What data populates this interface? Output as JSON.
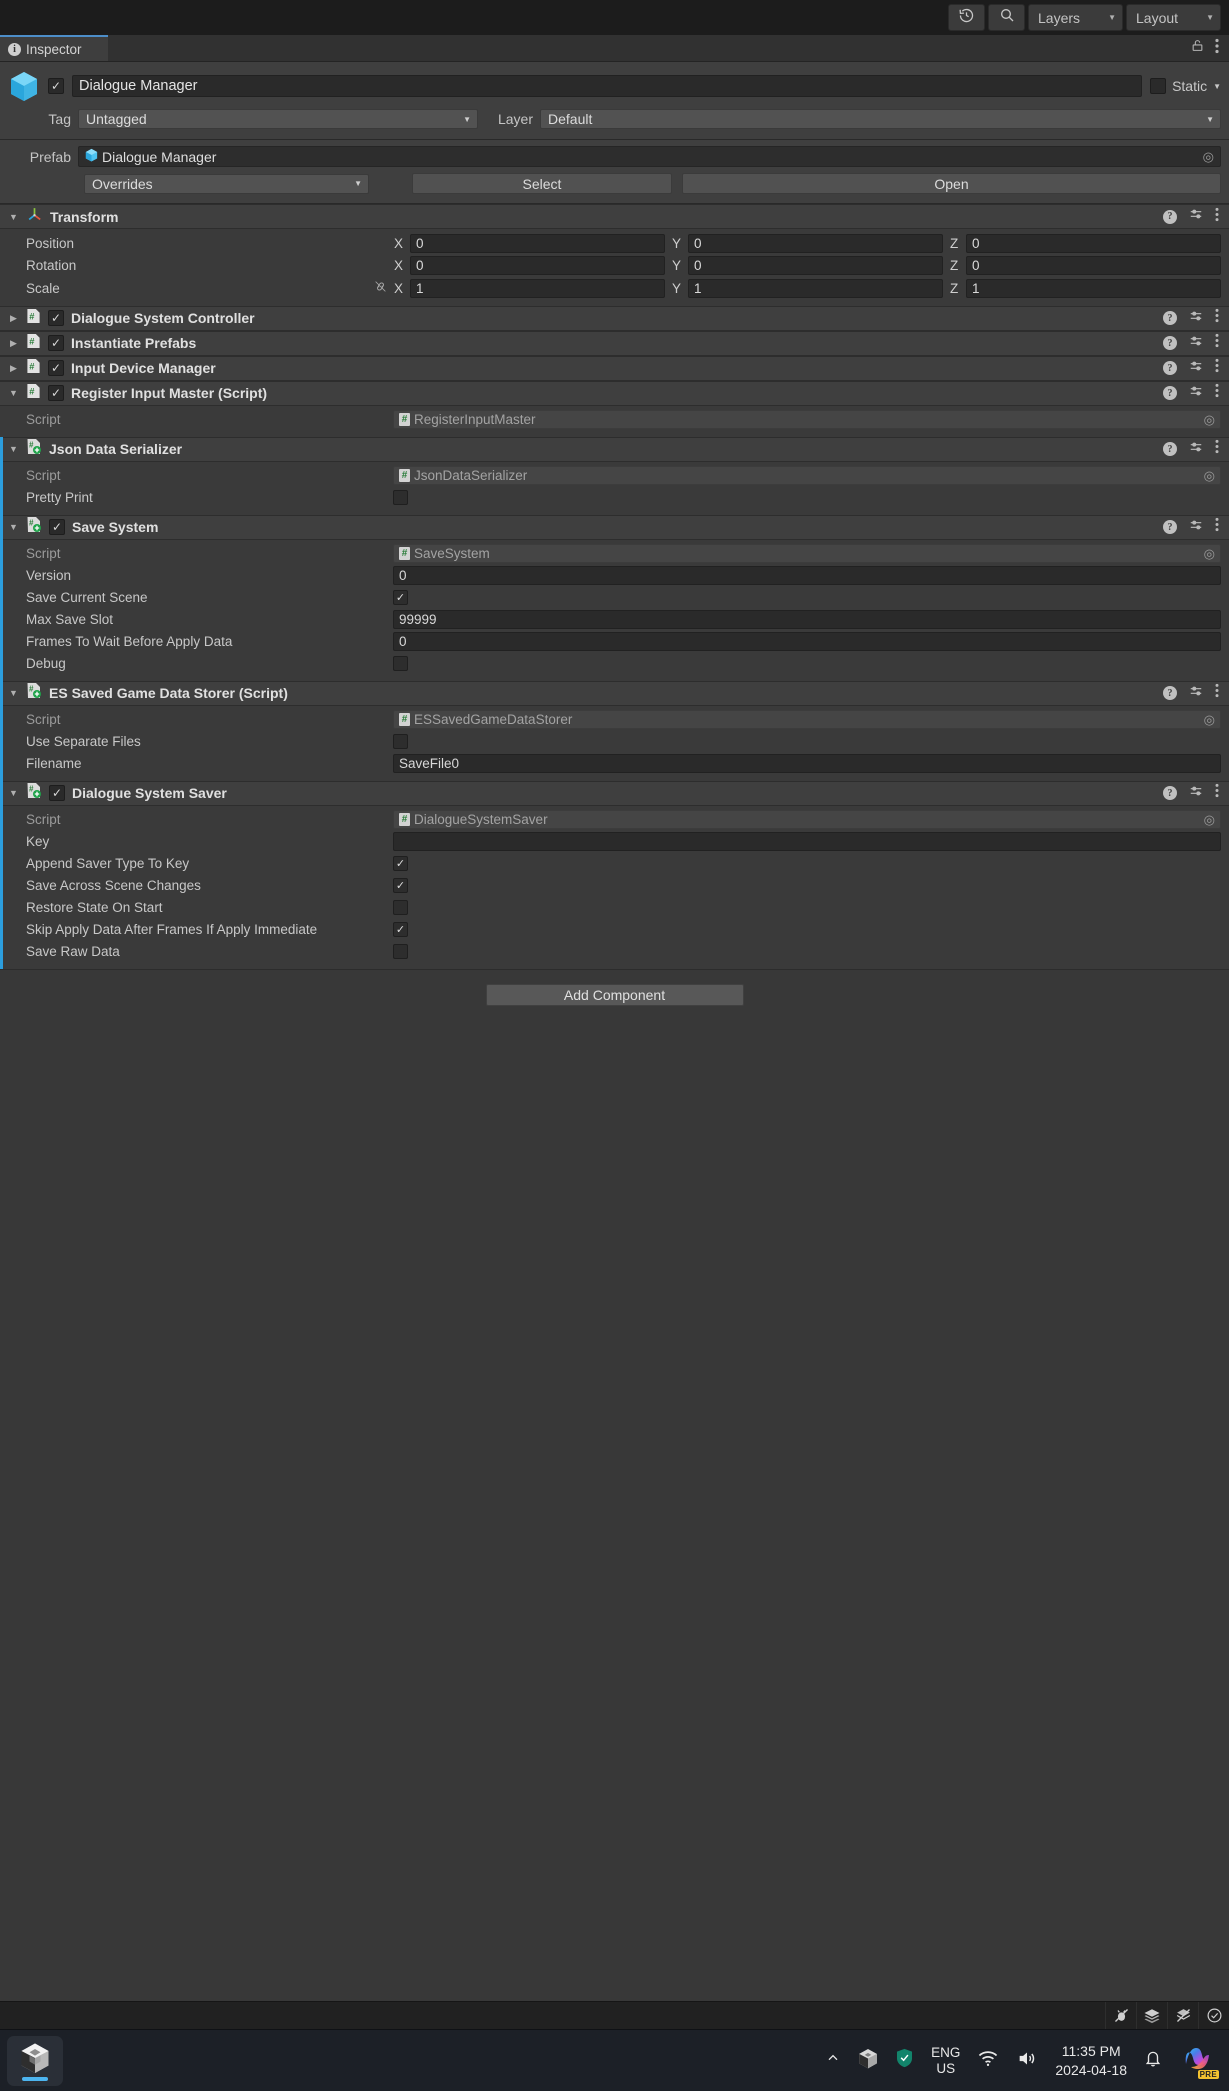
{
  "toolbar": {
    "history_icon": "history-icon",
    "search_icon": "search-icon",
    "layers_label": "Layers",
    "layout_label": "Layout"
  },
  "tabbar": {
    "inspector_tab": "Inspector",
    "lock_icon": "lock-icon",
    "menu_icon": "kebab-menu-icon"
  },
  "gameobject": {
    "enabled": true,
    "name": "Dialogue Manager",
    "static_label": "Static",
    "tag_label": "Tag",
    "tag_value": "Untagged",
    "layer_label": "Layer",
    "layer_value": "Default"
  },
  "prefab": {
    "label": "Prefab",
    "name": "Dialogue Manager",
    "overrides_label": "Overrides",
    "select_label": "Select",
    "open_label": "Open"
  },
  "transform": {
    "title": "Transform",
    "rows": [
      {
        "label": "Position",
        "x": "0",
        "y": "0",
        "z": "0"
      },
      {
        "label": "Rotation",
        "x": "0",
        "y": "0",
        "z": "0"
      },
      {
        "label": "Scale",
        "x": "1",
        "y": "1",
        "z": "1"
      }
    ],
    "axis_x": "X",
    "axis_y": "Y",
    "axis_z": "Z"
  },
  "collapsed_components": [
    {
      "title": "Dialogue System Controller",
      "enabled": true
    },
    {
      "title": "Instantiate Prefabs",
      "enabled": true
    },
    {
      "title": "Input Device Manager",
      "enabled": true
    }
  ],
  "components": [
    {
      "title": "Register Input Master (Script)",
      "has_checkbox": true,
      "enabled": true,
      "override": false,
      "icon": "cs-script-icon",
      "rows": [
        {
          "type": "object",
          "label": "Script",
          "value": "RegisterInputMaster",
          "dim": true
        }
      ]
    },
    {
      "title": "Json Data Serializer",
      "has_checkbox": false,
      "enabled": true,
      "override": true,
      "icon": "so-script-icon",
      "rows": [
        {
          "type": "object",
          "label": "Script",
          "value": "JsonDataSerializer",
          "dim": true
        },
        {
          "type": "check",
          "label": "Pretty Print",
          "checked": false
        }
      ]
    },
    {
      "title": "Save System",
      "has_checkbox": true,
      "enabled": true,
      "override": true,
      "icon": "so-script-icon",
      "rows": [
        {
          "type": "object",
          "label": "Script",
          "value": "SaveSystem",
          "dim": true
        },
        {
          "type": "text",
          "label": "Version",
          "value": "0"
        },
        {
          "type": "check",
          "label": "Save Current Scene",
          "checked": true
        },
        {
          "type": "text",
          "label": "Max Save Slot",
          "value": "99999"
        },
        {
          "type": "text",
          "label": "Frames To Wait Before Apply Data",
          "value": "0"
        },
        {
          "type": "check",
          "label": "Debug",
          "checked": false
        }
      ]
    },
    {
      "title": "ES Saved Game Data Storer (Script)",
      "has_checkbox": false,
      "enabled": true,
      "override": true,
      "icon": "so-script-icon",
      "rows": [
        {
          "type": "object",
          "label": "Script",
          "value": "ESSavedGameDataStorer",
          "dim": true
        },
        {
          "type": "check",
          "label": "Use Separate Files",
          "checked": false
        },
        {
          "type": "text",
          "label": "Filename",
          "value": "SaveFile0"
        }
      ]
    },
    {
      "title": "Dialogue System Saver",
      "has_checkbox": true,
      "enabled": true,
      "override": true,
      "icon": "so-script-icon",
      "rows": [
        {
          "type": "object",
          "label": "Script",
          "value": "DialogueSystemSaver",
          "dim": true
        },
        {
          "type": "text",
          "label": "Key",
          "value": ""
        },
        {
          "type": "check",
          "label": "Append Saver Type To Key",
          "checked": true
        },
        {
          "type": "check",
          "label": "Save Across Scene Changes",
          "checked": true
        },
        {
          "type": "check",
          "label": "Restore State On Start",
          "checked": false
        },
        {
          "type": "check",
          "label": "Skip Apply Data After Frames If Apply Immediate",
          "checked": true
        },
        {
          "type": "check",
          "label": "Save Raw Data",
          "checked": false
        }
      ]
    }
  ],
  "add_component_label": "Add Component",
  "statusbar": {
    "icons": [
      "bug-off-icon",
      "layers-stack-icon",
      "preview-pack-off-icon",
      "check-circle-icon"
    ]
  },
  "taskbar": {
    "app_icon": "unity-icon",
    "chevron_up_icon": "chevron-up-icon",
    "unity_hub_tray_icon": "unity-tray-icon",
    "security_icon": "shield-check-icon",
    "lang_line1": "ENG",
    "lang_line2": "US",
    "wifi_icon": "wifi-icon",
    "volume_icon": "volume-icon",
    "time": "11:35 PM",
    "date": "2024-04-18",
    "bell_icon": "notification-bell-icon",
    "copilot_icon": "copilot-icon",
    "copilot_badge": "PRE"
  },
  "colors": {
    "accent": "#4d8ec9",
    "override_bar": "#2c9ede",
    "unity_cube": "#4ec3f0",
    "taskbar_underline": "#4cb4ef"
  }
}
